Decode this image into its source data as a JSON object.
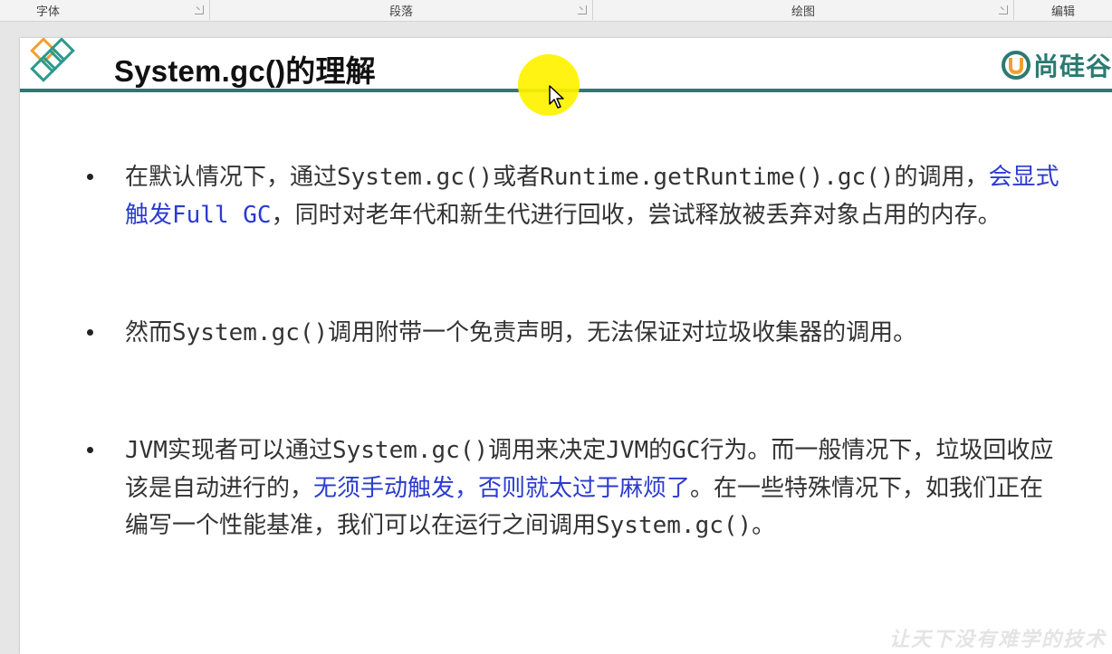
{
  "ribbon": {
    "groups": [
      {
        "label": "字体"
      },
      {
        "label": "段落"
      },
      {
        "label": "绘图"
      },
      {
        "label": "编辑"
      }
    ]
  },
  "slide": {
    "title": "System.gc()的理解",
    "brand": "尚硅谷",
    "watermark": "让天下没有难学的技术",
    "bullets": [
      {
        "segments": [
          {
            "text": "在默认情况下，通过System.gc()或者Runtime.getRuntime().gc()的调用，",
            "highlight": false
          },
          {
            "text": "会显式触发Full GC",
            "highlight": true
          },
          {
            "text": "，同时对老年代和新生代进行回收，尝试释放被丢弃对象占用的内存。",
            "highlight": false
          }
        ]
      },
      {
        "segments": [
          {
            "text": "然而System.gc()调用附带一个免责声明，无法保证对垃圾收集器的调用。",
            "highlight": false
          }
        ]
      },
      {
        "segments": [
          {
            "text": "JVM实现者可以通过System.gc()调用来决定JVM的GC行为。而一般情况下，垃圾回收应该是自动进行的，",
            "highlight": false
          },
          {
            "text": "无须手动触发，否则就太过于麻烦了",
            "highlight": true
          },
          {
            "text": "。在一些特殊情况下，如我们正在编写一个性能基准，我们可以在运行之间调用System.gc()。",
            "highlight": false
          }
        ]
      }
    ]
  },
  "colors": {
    "accent": "#2c7a72",
    "highlight_text": "#2b3bd1",
    "body_text": "#333333",
    "pointer_halo": "#fff200"
  }
}
